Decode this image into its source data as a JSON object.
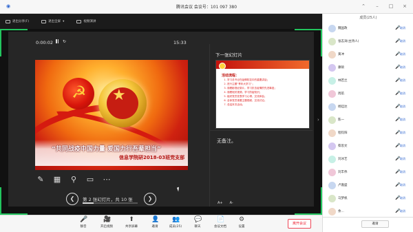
{
  "window": {
    "title": "腾讯会议 会议号：101 097 380"
  },
  "share_toolbar": {
    "items": [
      "退出分享(F)",
      "退出全屏",
      "视频演讲"
    ],
    "meeting_id": "会议号: 101 097 380"
  },
  "presenter": {
    "elapsed": "0:00:02",
    "clock": "15:33",
    "reset_symbol": "↻"
  },
  "slide": {
    "title": "“共同战疫中国力量 爱国力行吾辈担当”",
    "subtitle": "信息学院研2018-03班党支部",
    "badge_text": "★"
  },
  "navigation": {
    "status": "第 2 张幻灯片，共 10 张",
    "prev_symbol": "❮",
    "next_symbol": "❯",
    "progress": 0.2
  },
  "next_preview": {
    "label": "下一张幻灯片",
    "heading": "活动流程：",
    "items": [
      "学习总书记在疫情防控中的重要讲话；",
      "进行主题“青年大学习”；",
      "观看影视纪录片，学习抗击疫情的先进事迹；",
      "观看相关视频，学习防疫知识；",
      "组织党员发表学习心得，交流体会；",
      "全体党员观看主题视频，交流讨论；",
      "总结本次活动。"
    ]
  },
  "notes": {
    "text": "无备注。"
  },
  "font_buttons": [
    "A+",
    "A-"
  ],
  "collapse_symbol": "›",
  "bottom_toolbar": [
    {
      "label": "静音",
      "icon": "🎤"
    },
    {
      "label": "开启视频",
      "icon": "🎥"
    },
    {
      "label": "共享屏幕",
      "icon": "⬆"
    },
    {
      "label": "邀请",
      "icon": "👤"
    },
    {
      "label": "成员(25)",
      "icon": "👥"
    },
    {
      "label": "聊天",
      "icon": "💬"
    },
    {
      "label": "会议文档",
      "icon": "📄"
    },
    {
      "label": "设置",
      "icon": "⚙"
    }
  ],
  "leave_button": "离开会议",
  "members_panel": {
    "title": "成员(25人)",
    "invite_label": "邀请",
    "members": [
      {
        "name": "魏国政",
        "action": "取消"
      },
      {
        "name": "张志涛(主持人)",
        "action": "取消"
      },
      {
        "name": "黄冲",
        "action": "取消"
      },
      {
        "name": "康硕",
        "action": "取消"
      },
      {
        "name": "林若兰",
        "action": "取消"
      },
      {
        "name": "周航",
        "action": "取消"
      },
      {
        "name": "杨廷达",
        "action": "取消"
      },
      {
        "name": "陈一",
        "action": "取消"
      },
      {
        "name": "程钧阳",
        "action": "取消"
      },
      {
        "name": "蔡思文",
        "action": "取消"
      },
      {
        "name": "刘冰艺",
        "action": "取消"
      },
      {
        "name": "刘丰伟",
        "action": "取消"
      },
      {
        "name": "卢嘉盛",
        "action": "取消"
      },
      {
        "name": "马梦帆",
        "action": "取消"
      },
      {
        "name": "余...",
        "action": "取消"
      }
    ]
  }
}
